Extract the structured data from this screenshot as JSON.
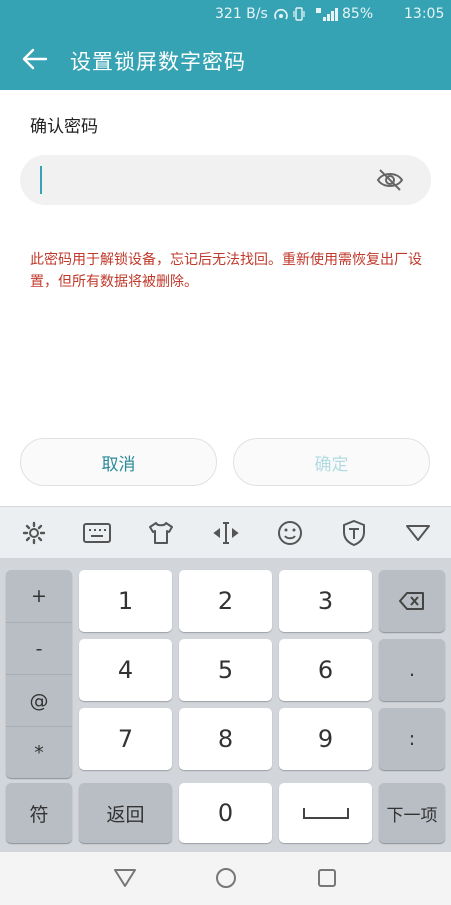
{
  "status_bar": {
    "network_speed": "321 B/s",
    "battery": "85%",
    "time": "13:05"
  },
  "header": {
    "title": "设置锁屏数字密码",
    "back_icon": "arrow-left-icon",
    "color": "#35a3b3"
  },
  "form": {
    "label": "确认密码",
    "password_value": "",
    "placeholder": "",
    "visibility_icon": "eye-off-icon",
    "warning": "此密码用于解锁设备，忘记后无法找回。重新使用需恢复出厂设置，但所有数据将被删除。"
  },
  "buttons": {
    "cancel": "取消",
    "confirm": "确定"
  },
  "keyboard": {
    "toolbar_icons": [
      "gear-icon",
      "keyboard-icon",
      "tshirt-icon",
      "cursor-move-icon",
      "smiley-icon",
      "shield-t-icon",
      "collapse-triangle-icon"
    ],
    "symbols": [
      "+",
      "-",
      "@",
      "*"
    ],
    "digits": [
      "1",
      "2",
      "3",
      "4",
      "5",
      "6",
      "7",
      "8",
      "9",
      "0"
    ],
    "dot": ".",
    "colon": ":",
    "sym_key": "符",
    "back_key": "返回",
    "next_key": "下一项"
  },
  "nav": {
    "icons": [
      "back-triangle-icon",
      "home-circle-icon",
      "recents-square-icon"
    ]
  }
}
